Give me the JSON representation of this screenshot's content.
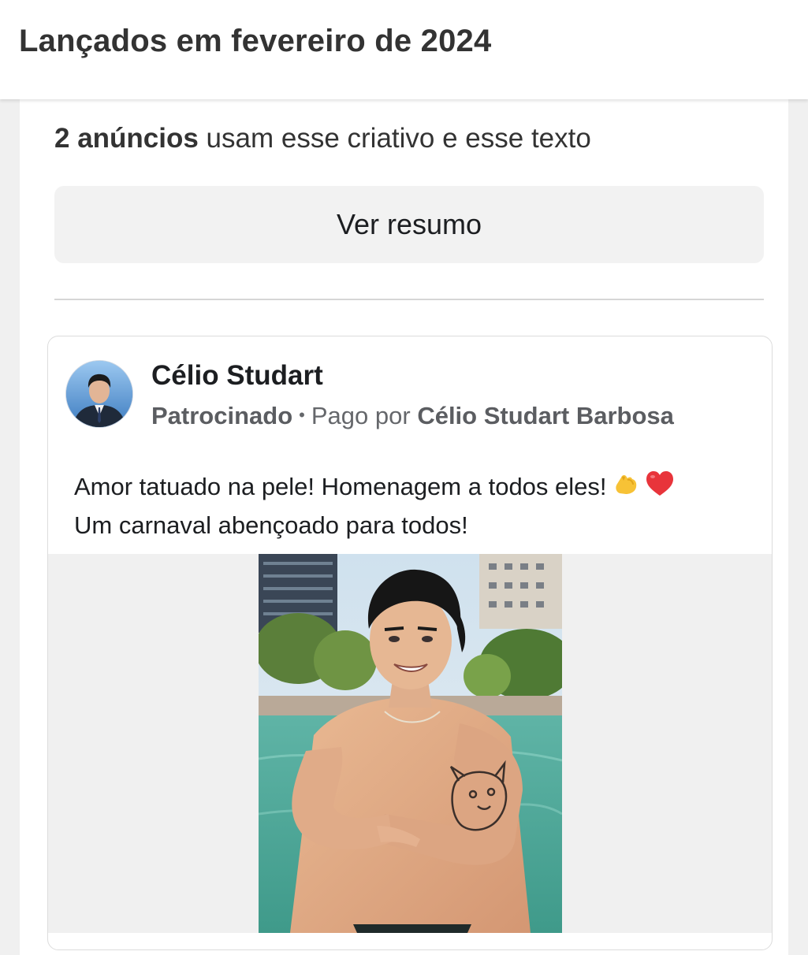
{
  "header": {
    "title": "Lançados em fevereiro de 2024"
  },
  "summary": {
    "count_bold": "2 anúncios",
    "count_rest": " usam esse criativo e esse texto",
    "view_summary_label": "Ver resumo"
  },
  "ad": {
    "advertiser_name": "Célio Studart",
    "sponsored_label": "Patrocinado",
    "separator": "•",
    "paid_by_prefix": "Pago por",
    "paid_by_name": "Célio Studart Barbosa",
    "body_line_1": "Amor tatuado na pele! Homenagem a todos eles!",
    "body_emojis": [
      "flexed-biceps-emoji",
      "red-heart-emoji"
    ],
    "body_line_2": "Um carnaval abençoado para todos!",
    "image_semantic": "man-in-pool-with-dog-tattoo-photo"
  },
  "colors": {
    "page_bg": "#f0f0f0",
    "card_bg": "#ffffff",
    "button_bg": "#f2f2f2",
    "text_primary": "#1c1e21",
    "text_secondary": "#65676b"
  }
}
